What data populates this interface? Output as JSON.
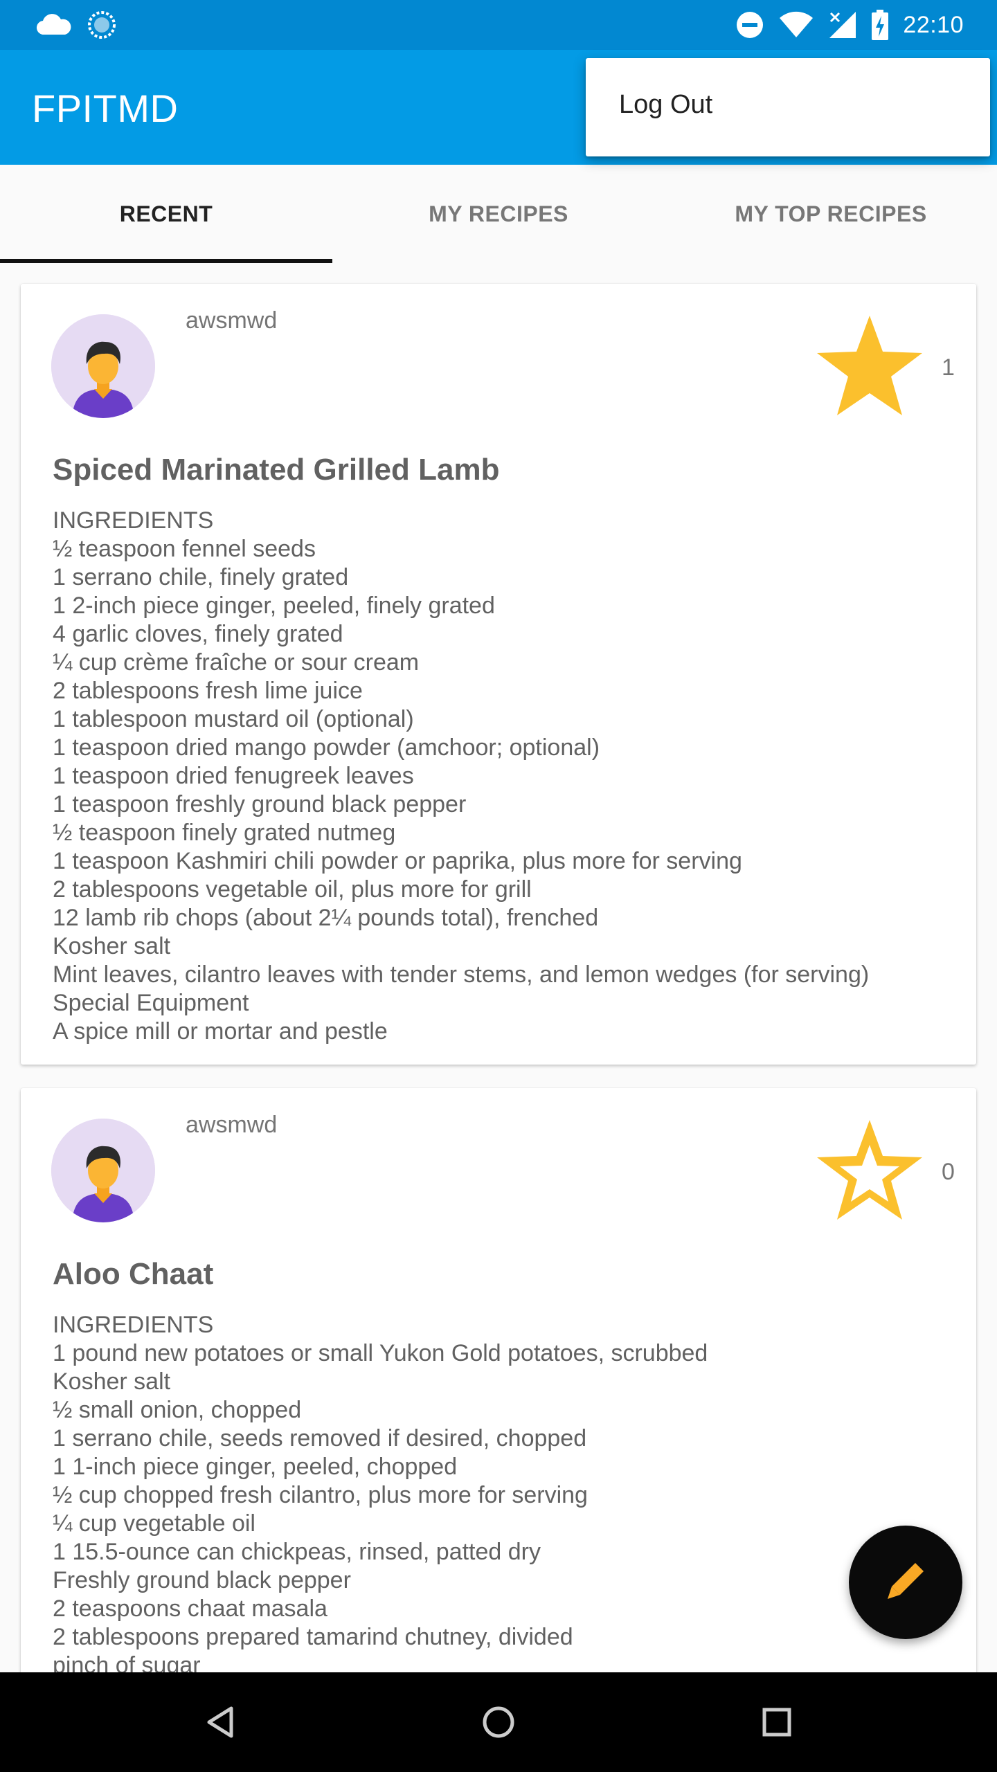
{
  "status_bar": {
    "time": "22:10",
    "left_icons": [
      "cloud-icon",
      "sync-icon"
    ],
    "right_icons": [
      "do-not-disturb-icon",
      "wifi-icon",
      "cell-signal-icon",
      "battery-charging-icon"
    ]
  },
  "app_bar": {
    "title": "FPITMD"
  },
  "menu": {
    "items": [
      {
        "label": "Log Out"
      }
    ]
  },
  "tabs": [
    {
      "label": "RECENT",
      "active": true
    },
    {
      "label": "MY RECIPES",
      "active": false
    },
    {
      "label": "MY TOP RECIPES",
      "active": false
    }
  ],
  "posts": [
    {
      "author": "awsmwd",
      "starred": true,
      "star_count": "1",
      "title": "Spiced Marinated Grilled Lamb",
      "body": [
        "INGREDIENTS",
        "½ teaspoon fennel seeds",
        "1 serrano chile, finely grated",
        "1 2-inch piece ginger, peeled, finely grated",
        "4 garlic cloves, finely grated",
        "¼ cup crème fraîche or sour cream",
        "2 tablespoons fresh lime juice",
        "1 tablespoon mustard oil (optional)",
        "1 teaspoon dried mango powder (amchoor; optional)",
        "1 teaspoon dried fenugreek leaves",
        "1 teaspoon freshly ground black pepper",
        "½ teaspoon finely grated nutmeg",
        "1 teaspoon Kashmiri chili powder or paprika, plus more for serving",
        "2 tablespoons vegetable oil, plus more for grill",
        "12 lamb rib chops (about 2¼ pounds total), frenched",
        "Kosher salt",
        "Mint leaves, cilantro leaves with tender stems, and lemon wedges (for serving)",
        "Special Equipment",
        "A spice mill or mortar and pestle"
      ]
    },
    {
      "author": "awsmwd",
      "starred": false,
      "star_count": "0",
      "title": "Aloo Chaat",
      "body": [
        "INGREDIENTS",
        "1 pound new potatoes or small Yukon Gold potatoes, scrubbed",
        "Kosher salt",
        "½ small onion, chopped",
        "1 serrano chile, seeds removed if desired, chopped",
        "1 1-inch piece ginger, peeled, chopped",
        "½ cup chopped fresh cilantro, plus more for serving",
        "¼ cup vegetable oil",
        "1 15.5-ounce can chickpeas, rinsed, patted dry",
        "Freshly ground black pepper",
        "2 teaspoons chaat masala",
        "2 tablespoons prepared tamarind chutney, divided",
        "pinch of sugar"
      ]
    }
  ],
  "fab": {
    "icon": "pencil-icon"
  },
  "nav_bar": {
    "icons": [
      "back-icon",
      "home-icon",
      "recents-icon"
    ]
  },
  "colors": {
    "status_bar": "#0288d1",
    "app_bar": "#039be5",
    "star": "#fbc02d",
    "fab": "#0a0a0a",
    "fab_icon": "#f9a825"
  }
}
